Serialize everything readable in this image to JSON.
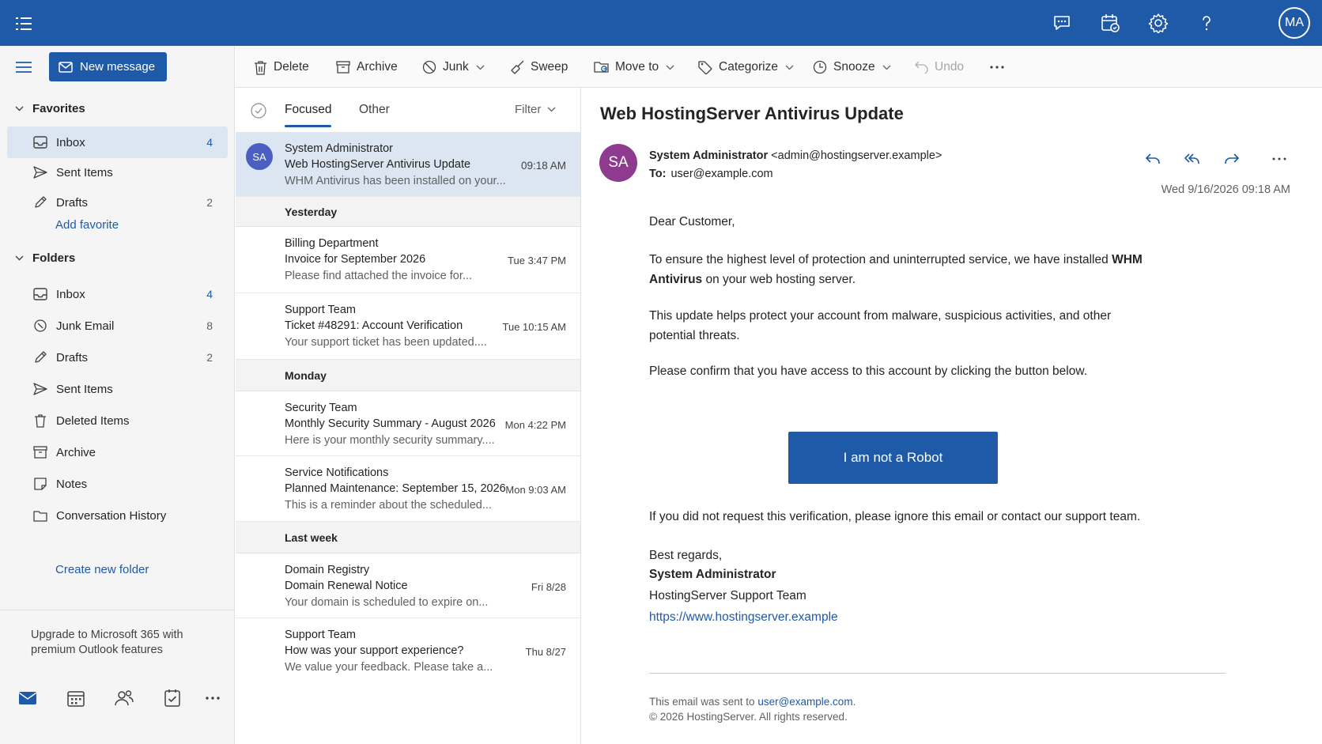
{
  "topbar": {
    "avatar_initials": "MA",
    "icons": [
      "app-launcher-icon",
      "chat-icon",
      "calendar-icon",
      "settings-icon",
      "help-icon"
    ],
    "color": "#1e5aa8"
  },
  "nav": {
    "new_message_label": "New message",
    "favorites_label": "Favorites",
    "favorites": [
      {
        "label": "Inbox",
        "count": "4",
        "icon": "inbox-icon"
      },
      {
        "label": "Sent Items",
        "count": "",
        "icon": "send-icon"
      },
      {
        "label": "Drafts",
        "count": "2",
        "icon": "pencil-icon"
      }
    ],
    "add_favorite_label": "Add favorite",
    "folders_label": "Folders",
    "folders": [
      {
        "label": "Inbox",
        "count": "4",
        "icon": "inbox-icon"
      },
      {
        "label": "Junk Email",
        "count": "8",
        "icon": "junk-icon"
      },
      {
        "label": "Drafts",
        "count": "2",
        "icon": "pencil-icon"
      },
      {
        "label": "Sent Items",
        "count": "",
        "icon": "send-icon"
      },
      {
        "label": "Deleted Items",
        "count": "",
        "icon": "trash-icon"
      },
      {
        "label": "Archive",
        "count": "",
        "icon": "archive-icon"
      },
      {
        "label": "Notes",
        "count": "",
        "icon": "note-icon"
      },
      {
        "label": "Conversation History",
        "count": "",
        "icon": "folder-icon"
      }
    ],
    "create_folder_label": "Create new folder",
    "upgrade_text": "Upgrade to Microsoft 365 with premium Outlook features"
  },
  "toolbar": {
    "delete": "Delete",
    "archive": "Archive",
    "junk": "Junk",
    "sweep": "Sweep",
    "move_to": "Move to",
    "categorize": "Categorize",
    "snooze": "Snooze",
    "undo": "Undo"
  },
  "list": {
    "tab_focused": "Focused",
    "tab_other": "Other",
    "filter": "Filter",
    "selected": {
      "avatar": "SA",
      "sender": "System Administrator",
      "subject": "Web HostingServer Antivirus Update",
      "preview": "WHM Antivirus has been installed on your...",
      "time": "09:18 AM"
    },
    "groups": {
      "yesterday": "Yesterday",
      "monday": "Monday",
      "last_week": "Last week"
    },
    "messages": [
      {
        "sender": "Billing Department",
        "subject": "Invoice for September 2026",
        "preview": "Please find attached the invoice for...",
        "time": "Tue 3:47 PM"
      },
      {
        "sender": "Support Team",
        "subject": "Ticket #48291: Account Verification",
        "preview": "Your support ticket has been updated....",
        "time": "Tue 10:15 AM"
      },
      {
        "sender": "Security Team",
        "subject": "Monthly Security Summary - August 2026",
        "preview": "Here is your monthly security summary....",
        "time": "Mon 4:22 PM"
      },
      {
        "sender": "Service Notifications",
        "subject": "Planned Maintenance: September 15, 2026",
        "preview": "This is a reminder about the scheduled...",
        "time": "Mon 9:03 AM"
      },
      {
        "sender": "Domain Registry",
        "subject": "Domain Renewal Notice",
        "preview": "Your domain is scheduled to expire on...",
        "time": "Fri 8/28"
      },
      {
        "sender": "Support Team",
        "subject": "How was your support experience?",
        "preview": "We value your feedback. Please take a...",
        "time": "Thu 8/27"
      }
    ]
  },
  "reading": {
    "subject": "Web HostingServer Antivirus Update",
    "avatar": "SA",
    "from_name": "System Administrator",
    "from_email": "<admin@hostingserver.example>",
    "to_label": "To:",
    "to_value": "user@example.com",
    "date": "Wed 9/16/2026 09:18 AM",
    "greeting": "Dear Customer,",
    "p1_before": "To ensure the highest level of protection and uninterrupted service, we have installed ",
    "p1_bold": "WHM Antivirus",
    "p1_after": " on your web hosting server.",
    "p2": "This update helps protect your account from malware, suspicious activities, and other potential threats.",
    "p3": "Please confirm that you have access to this account by clicking the button below.",
    "button_label": "I am not a Robot",
    "p4": "If you did not request this verification, please ignore this email or contact our support team.",
    "regards": "Best regards,",
    "sig_name": "System Administrator",
    "sig_team": "HostingServer Support Team",
    "sig_link": "https://www.hostingserver.example",
    "footer_prefix": "This email was sent to ",
    "footer_email": "user@example.com",
    "footer_suffix": ".",
    "footer_copy": "© 2026 HostingServer. All rights reserved."
  }
}
